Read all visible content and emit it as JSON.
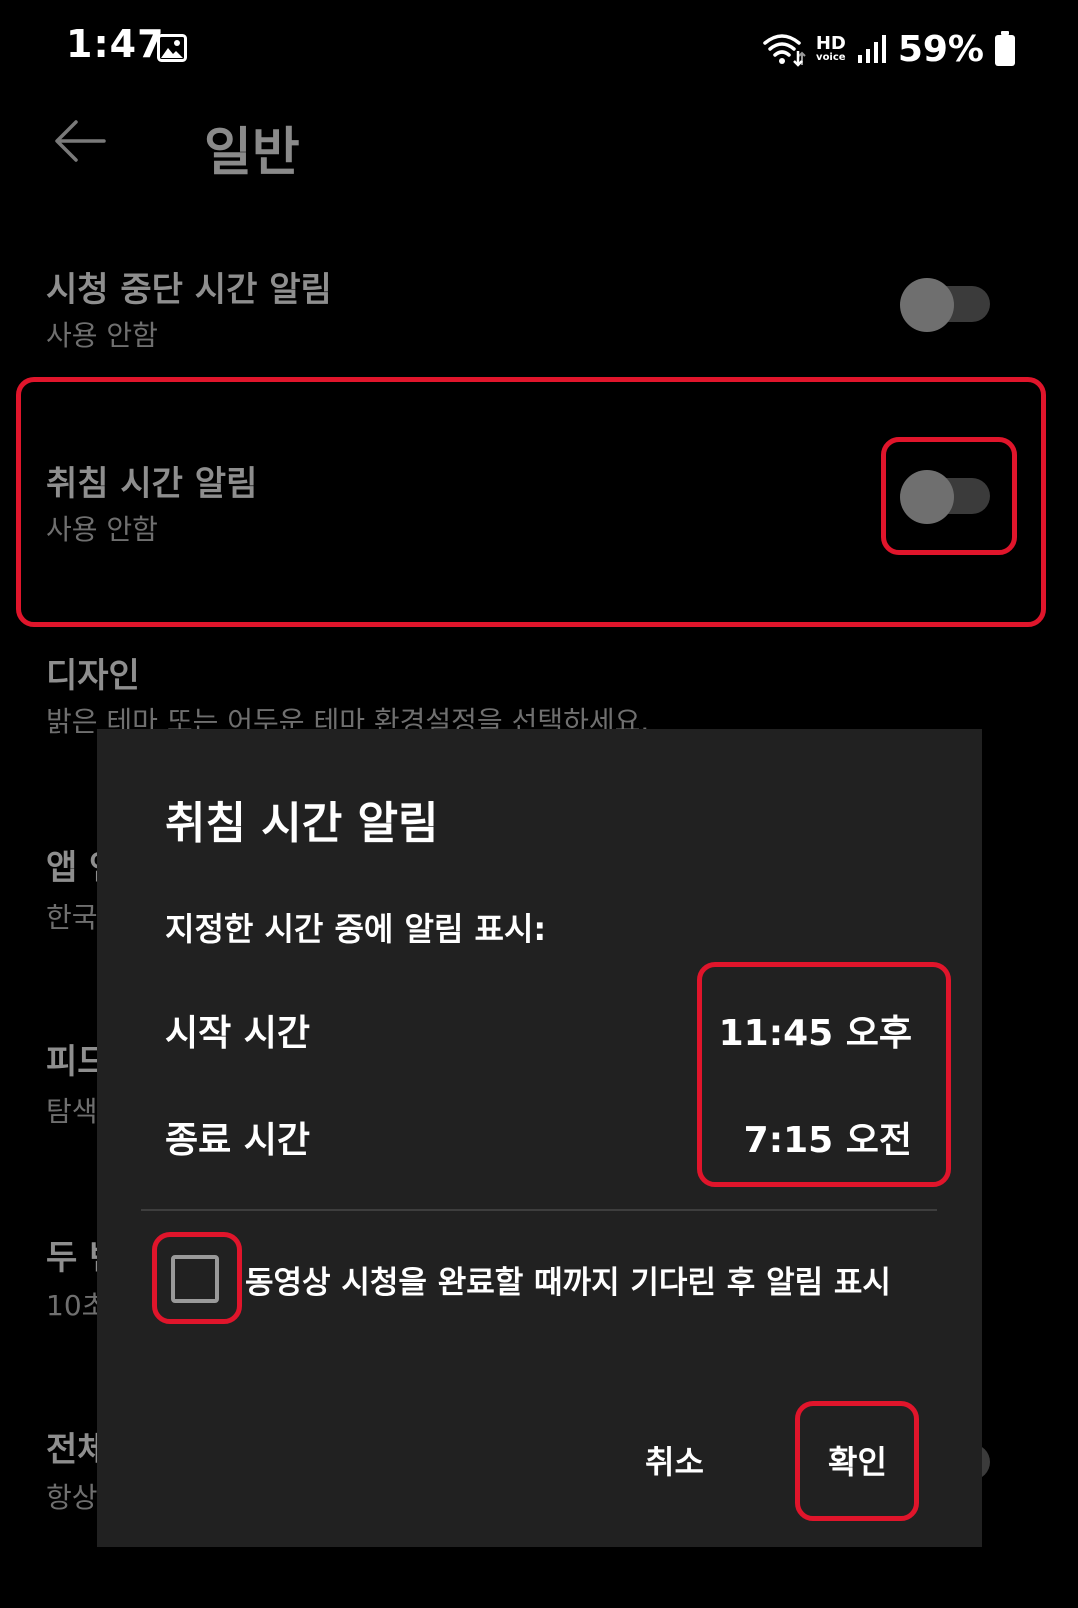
{
  "status_bar": {
    "time": "1:47",
    "hd": "HD",
    "voice": "voice",
    "battery": "59%"
  },
  "header": {
    "title": "일반"
  },
  "settings": {
    "watch_break": {
      "title": "시청 중단 시간 알림",
      "subtitle": "사용 안함",
      "enabled": false
    },
    "bedtime": {
      "title": "취침 시간 알림",
      "subtitle": "사용 안함",
      "enabled": false
    },
    "design": {
      "title": "디자인",
      "subtitle": "밝은 테마 또는 어두운 테마 환경설정을 선택하세요."
    },
    "app_language": {
      "title": "앱 언어",
      "subtitle": "한국어"
    },
    "picture_in_picture": {
      "title": "피드",
      "subtitle": "탐색"
    },
    "double_tap": {
      "title": "두 번",
      "subtitle": "10초"
    },
    "full_screen": {
      "title": "전체",
      "subtitle": "항상"
    }
  },
  "dialog": {
    "title": "취침 시간 알림",
    "subtitle": "지정한 시간 중에 알림 표시:",
    "start_label": "시작 시간",
    "start_value": "11:45 오후",
    "end_label": "종료 시간",
    "end_value": "7:15 오전",
    "checkbox_label": "동영상 시청을 완료할 때까지 기다린 후 알림 표시",
    "checkbox_checked": false,
    "cancel_label": "취소",
    "confirm_label": "확인"
  },
  "colors": {
    "background": "#000000",
    "dialog_background": "#212121",
    "highlight": "#e0152b",
    "muted_text": "#8e8e8e"
  },
  "icons": {
    "back": "arrow-left-icon",
    "gallery": "gallery-icon",
    "wifi": "wifi-icon",
    "signal": "signal-icon",
    "battery": "battery-icon"
  }
}
